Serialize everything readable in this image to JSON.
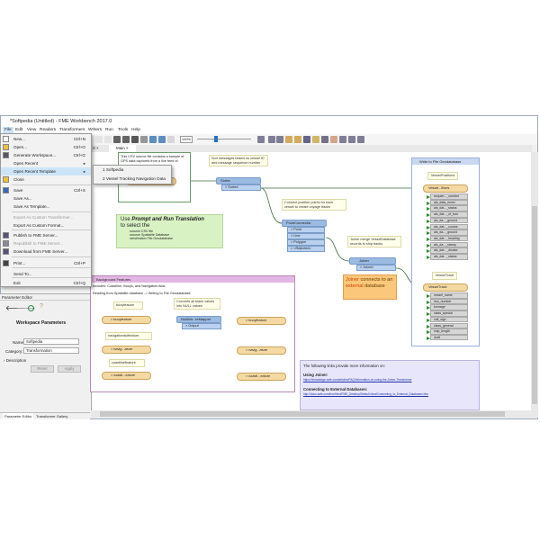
{
  "window": {
    "title": "*Softpedia (Untitled) - FME Workbench 2017.0"
  },
  "menubar": [
    "File",
    "Edit",
    "View",
    "Readers",
    "Transformers",
    "Writers",
    "Run",
    "Tools",
    "Help"
  ],
  "toolbar": {
    "zoom": "100%"
  },
  "tabs": [
    "rt",
    "Main"
  ],
  "file_menu": [
    {
      "label": "New...",
      "shortcut": "Ctrl+N"
    },
    {
      "label": "Open...",
      "shortcut": "Ctrl+O"
    },
    {
      "label": "Generate Workspace...",
      "shortcut": "Ctrl+G"
    },
    {
      "label": "Open Recent",
      "shortcut": "▸"
    },
    {
      "label": "Open Recent Template",
      "shortcut": "▸"
    },
    {
      "label": "Close",
      "shortcut": ""
    },
    {
      "label": "Save",
      "shortcut": "Ctrl+S"
    },
    {
      "label": "Save As...",
      "shortcut": ""
    },
    {
      "label": "Save As Template...",
      "shortcut": ""
    },
    {
      "label": "Export As Custom Transformer...",
      "shortcut": ""
    },
    {
      "label": "Export As Custom Format...",
      "shortcut": ""
    },
    {
      "label": "Publish to FME Server...",
      "shortcut": ""
    },
    {
      "label": "Republish to FME Server...",
      "shortcut": ""
    },
    {
      "label": "Download from FME Server...",
      "shortcut": ""
    },
    {
      "label": "Print...",
      "shortcut": "Ctrl+P"
    },
    {
      "label": "Send To...",
      "shortcut": ""
    },
    {
      "label": "Exit",
      "shortcut": "Ctrl+Q"
    }
  ],
  "recent_templates": [
    "1 Softpedia",
    "2 Vessel Tracking  Navigation Data"
  ],
  "parameter_editor": {
    "header": "Parameter Editor",
    "section": "Workspace Parameters",
    "name_label": "Name:",
    "name_value": "Softpedia",
    "category_label": "Category:",
    "category_value": "Transformation",
    "description": "Description",
    "reset": "Reset",
    "apply": "Apply",
    "tabs": [
      "Parameter Editor",
      "Transformer Gallery"
    ]
  },
  "canvas": {
    "csv_note": "This CSV source file contains a sample of GPS data captured from a live feed of",
    "sort_note": "Sort messages based on vessel ID and message sequence number",
    "sorter": "Sorter",
    "sorter_port": "> Sorted",
    "connect_note": "Connect position points for each vessel to create voyage tracks",
    "pointconnector": "PointConnector",
    "pc_ports": [
      "> Point",
      "> Line",
      "> Polygon",
      "> <Rejected>"
    ],
    "prompt": {
      "use": "Use ",
      "bold": "Prompt and Run Translation",
      "line2": "to select the",
      "bullets": [
        "source CSV file",
        "source Spatialite Database",
        "destination File Geodatabase"
      ]
    },
    "joiner_note": "Joiner merge VesselDatabase records to ship tracks",
    "joiner": "Joiner",
    "joiner_port": "> Joined",
    "joiner_callout": {
      "a": "Joiner",
      "b": " connects to an ",
      "c": "external",
      "d": " database"
    },
    "writer_bookmark": "Write to File Geodatabase",
    "vp_label": "VesselPositions",
    "vp_node": "Vessel...itions",
    "vp_attrs": [
      "sequen..._number",
      "ais_data_mmsi",
      "ais_dat..._status",
      "ais_dat..._of_turn",
      "ais_da..._ground",
      "ais_dat..._course",
      "ais_da..._ground",
      "ais_dat..._heading",
      "ais_da..._stamp",
      "ais_dat..._dicator",
      "ais_dat..._status"
    ],
    "vt_label": "VesselTrack",
    "vt_node": "VesselTrack",
    "vt_attrs": [
      "vessel_name",
      "imo_number",
      "tonnage",
      "class_special",
      "call_sign",
      "class_general",
      "ship_length",
      "draft"
    ],
    "bg_bookmark": "Background Features",
    "bg_includes": "Includes:  Coastline, Buoys, and Navigation Aids",
    "bg_reading": "Reading from Spatialite database -> Writing to File Geodatabase",
    "buoy_note": "buoyfeature",
    "null_note": "Converts all blank values into NULL values",
    "buoy_reader": "> buoyfeature",
    "null_node": "NullAttr...teMapper",
    "null_port": "> Output",
    "buoy_writer": "> buoyfeature",
    "nav_note": "navigationaidfeature",
    "nav_reader": "> navig...ature",
    "nav_writer": "> navig...ature",
    "coast_note": "coastlinefeature",
    "coast_reader": "> coastl...eature",
    "coast_writer": "> coastl...eature",
    "links": {
      "intro": "The following links provide more information on:",
      "h1": "Using Joiner:",
      "u1": "https://knowledge.safe.com/articles/FAQ/Information-on-using-the-Joiner-Transformer",
      "h2": "Connecting to External Databases:",
      "u2": "http://docs.safe.com/fme/html/FME_Desktop/Default.htm#Connecting_to_External_Databases.htm"
    }
  }
}
